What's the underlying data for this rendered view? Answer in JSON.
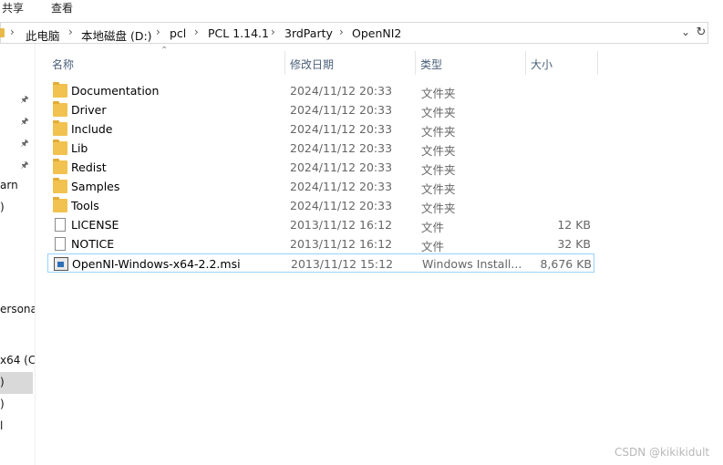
{
  "ribbon": {
    "share_label": "共享",
    "view_label": "查看"
  },
  "address": {
    "crumbs": [
      "此电脑",
      "本地磁盘 (D:)",
      "pcl",
      "PCL 1.14.1",
      "3rdParty",
      "OpenNI2"
    ],
    "separator": "›",
    "dropdown_icon": "chevron-down-icon",
    "refresh_icon": "refresh-icon"
  },
  "nav": {
    "items": [
      "arn",
      ")",
      "ersona",
      "x64 (C",
      ")",
      ")",
      "l"
    ],
    "pin_icon": "pin-icon"
  },
  "columns": {
    "name": "名称",
    "date": "修改日期",
    "type": "类型",
    "size": "大小"
  },
  "files": [
    {
      "name": "Documentation",
      "date": "2024/11/12 20:33",
      "type": "文件夹",
      "size": "",
      "icon": "folder-icon"
    },
    {
      "name": "Driver",
      "date": "2024/11/12 20:33",
      "type": "文件夹",
      "size": "",
      "icon": "folder-icon"
    },
    {
      "name": "Include",
      "date": "2024/11/12 20:33",
      "type": "文件夹",
      "size": "",
      "icon": "folder-icon"
    },
    {
      "name": "Lib",
      "date": "2024/11/12 20:33",
      "type": "文件夹",
      "size": "",
      "icon": "folder-icon"
    },
    {
      "name": "Redist",
      "date": "2024/11/12 20:33",
      "type": "文件夹",
      "size": "",
      "icon": "folder-icon"
    },
    {
      "name": "Samples",
      "date": "2024/11/12 20:33",
      "type": "文件夹",
      "size": "",
      "icon": "folder-icon"
    },
    {
      "name": "Tools",
      "date": "2024/11/12 20:33",
      "type": "文件夹",
      "size": "",
      "icon": "folder-icon"
    },
    {
      "name": "LICENSE",
      "date": "2013/11/12 16:12",
      "type": "文件",
      "size": "12 KB",
      "icon": "file-icon"
    },
    {
      "name": "NOTICE",
      "date": "2013/11/12 16:12",
      "type": "文件",
      "size": "32 KB",
      "icon": "file-icon"
    },
    {
      "name": "OpenNI-Windows-x64-2.2.msi",
      "date": "2013/11/12 15:12",
      "type": "Windows Install...",
      "size": "8,676 KB",
      "icon": "msi-installer-icon"
    }
  ],
  "watermark": "CSDN @kikikidult",
  "colors": {
    "folder": "#f1c24f",
    "selection_border": "#99d1ff",
    "header_text": "#4c607a"
  }
}
